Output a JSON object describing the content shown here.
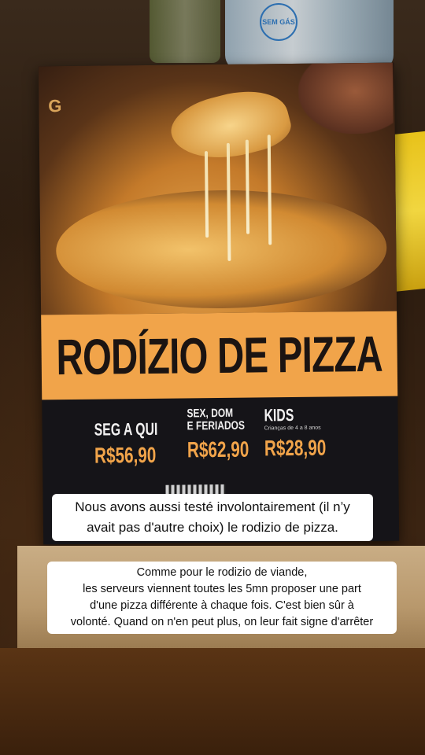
{
  "photo_scene": {
    "bottle_label": "SEM GÁS",
    "card_logo": "G"
  },
  "menu_card": {
    "title": "RODÍZIO DE PIZZA",
    "columns": [
      {
        "days": "SEG A QUI",
        "sub": "",
        "price": "R$56,90"
      },
      {
        "days": "SEX, DOM E FERIADOS",
        "days_line1": "SEX, DOM",
        "days_line2": "E FERIADOS",
        "sub": "",
        "price": "R$62,90"
      },
      {
        "days": "KIDS",
        "sub": "Crianças de 4 a 8 anos",
        "price": "R$28,90"
      }
    ]
  },
  "captions": {
    "first": {
      "line1": "Nous avons aussi testé involontairement (il n’y",
      "line2": "avait pas d'autre choix) le rodizio de pizza."
    },
    "second": {
      "line1": "Comme pour le rodizio de viande,",
      "line2": "les serveurs viennent toutes les 5mn proposer une part",
      "line3": "d'une pizza différente à chaque fois. C'est bien sûr à",
      "line4": "volonté. Quand on n'en peut plus, on leur fait signe d'arrêter"
    }
  },
  "colors": {
    "banner": "#f1a44a",
    "card": "#151418",
    "price": "#f1a44a"
  }
}
